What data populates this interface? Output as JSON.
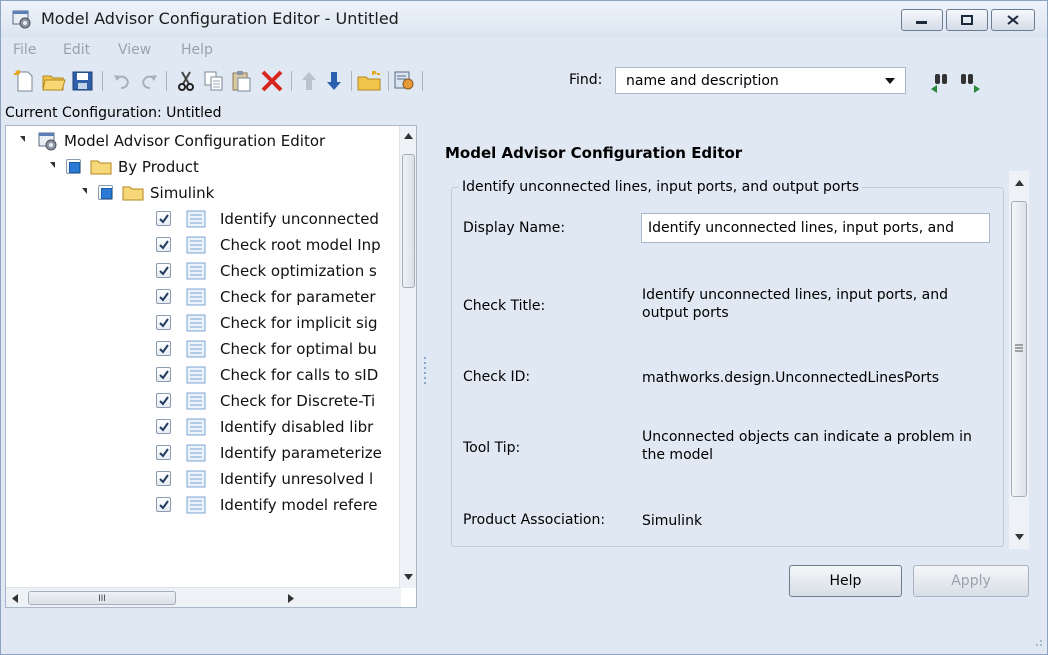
{
  "window": {
    "title": "Model Advisor Configuration Editor - Untitled"
  },
  "menu": [
    "File",
    "Edit",
    "View",
    "Help"
  ],
  "toolbar": {
    "find_label": "Find:",
    "find_value": "name and description"
  },
  "left_panel": {
    "config_label": "Current Configuration: Untitled",
    "tree": {
      "root": "Model Advisor Configuration Editor",
      "by_product": "By Product",
      "simulink": "Simulink",
      "checks": [
        "Identify unconnected",
        "Check root model Inp",
        "Check optimization s",
        "Check for parameter",
        "Check for implicit sig",
        "Check for optimal bu",
        "Check for calls to sID",
        "Check for Discrete-Ti",
        "Identify disabled libr",
        "Identify parameterize",
        "Identify unresolved l",
        "Identify model refere"
      ]
    },
    "hscroll_grip": "III"
  },
  "right_panel": {
    "title": "Model Advisor Configuration Editor",
    "group_legend": "Identify unconnected lines, input ports, and output ports",
    "fields": {
      "display_name_label": "Display Name:",
      "display_name_value": "Identify unconnected lines, input ports, and",
      "check_title_label": "Check Title:",
      "check_title_value": "Identify unconnected lines, input ports, and output ports",
      "check_id_label": "Check ID:",
      "check_id_value": "mathworks.design.UnconnectedLinesPorts",
      "tool_tip_label": "Tool Tip:",
      "tool_tip_value": "Unconnected objects can indicate a problem in the model",
      "product_association_label": "Product Association:",
      "product_association_value": "Simulink"
    },
    "buttons": {
      "help": "Help",
      "apply": "Apply"
    }
  },
  "colors": {
    "window_bg": "#dfe8f3",
    "checkbox_fill": "#2b7bd6",
    "delete_red": "#d7261e",
    "arrow_blue": "#2a5fb0"
  }
}
